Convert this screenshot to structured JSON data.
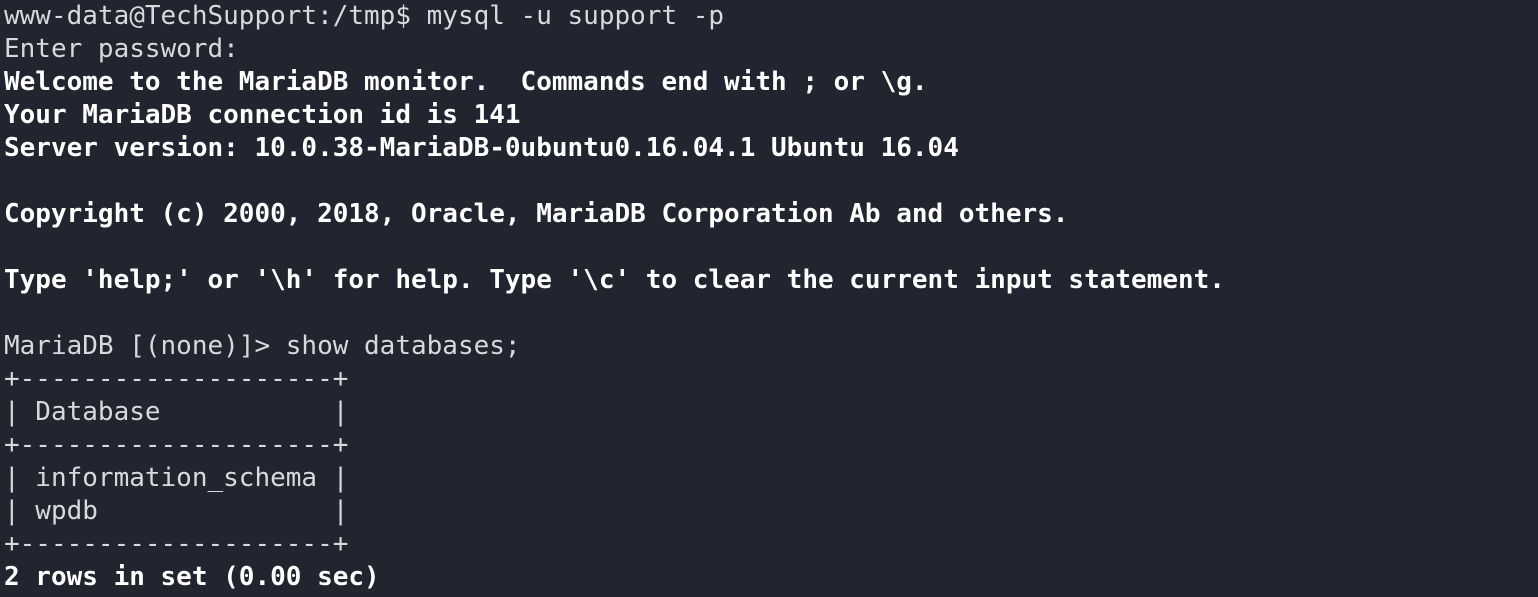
{
  "terminal": {
    "lines": [
      {
        "text": "www-data@TechSupport:/tmp$ mysql -u support -p",
        "style": "normal"
      },
      {
        "text": "Enter password:",
        "style": "normal"
      },
      {
        "text": "Welcome to the MariaDB monitor.  Commands end with ; or \\g.",
        "style": "bold"
      },
      {
        "text": "Your MariaDB connection id is 141",
        "style": "bold"
      },
      {
        "text": "Server version: 10.0.38-MariaDB-0ubuntu0.16.04.1 Ubuntu 16.04",
        "style": "bold"
      },
      {
        "text": "",
        "style": "normal"
      },
      {
        "text": "Copyright (c) 2000, 2018, Oracle, MariaDB Corporation Ab and others.",
        "style": "bold"
      },
      {
        "text": "",
        "style": "normal"
      },
      {
        "text": "Type 'help;' or '\\h' for help. Type '\\c' to clear the current input statement.",
        "style": "bold"
      },
      {
        "text": "",
        "style": "normal"
      },
      {
        "text": "MariaDB [(none)]> show databases;",
        "style": "normal"
      },
      {
        "text": "+--------------------+",
        "style": "normal"
      },
      {
        "text": "| Database           |",
        "style": "normal"
      },
      {
        "text": "+--------------------+",
        "style": "normal"
      },
      {
        "text": "| information_schema |",
        "style": "normal"
      },
      {
        "text": "| wpdb               |",
        "style": "normal"
      },
      {
        "text": "+--------------------+",
        "style": "normal"
      },
      {
        "text": "2 rows in set (0.00 sec)",
        "style": "bold"
      }
    ]
  }
}
